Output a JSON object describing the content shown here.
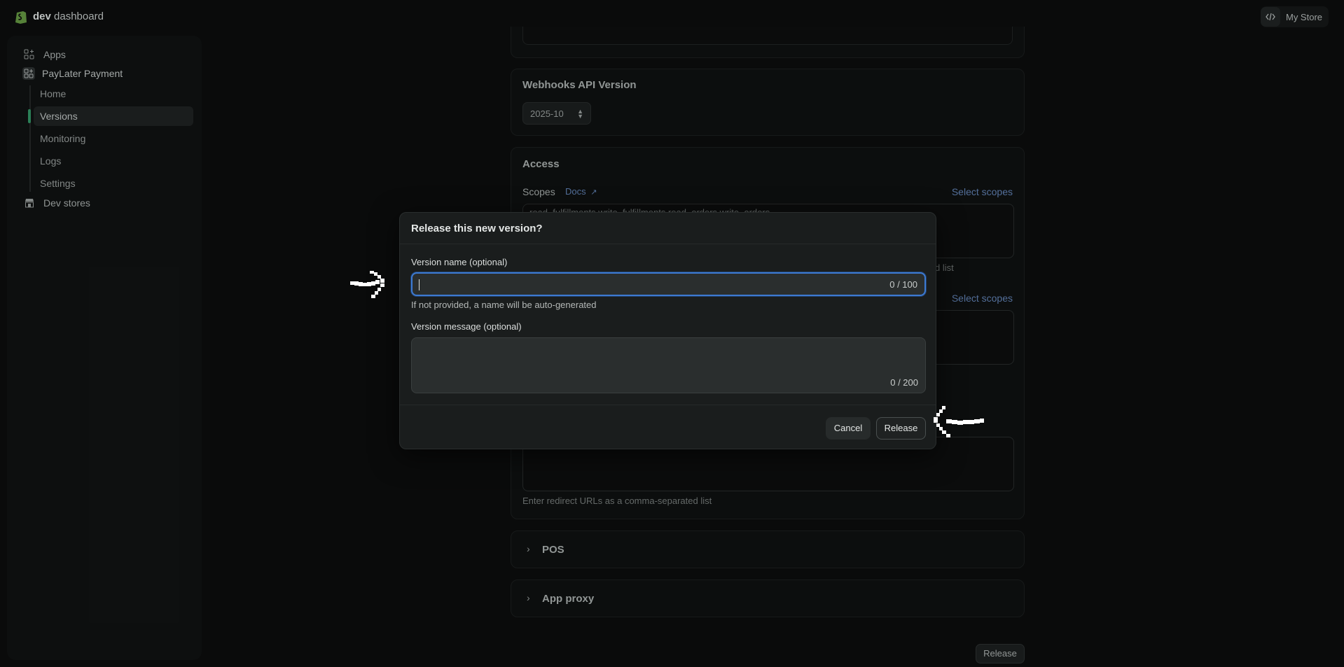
{
  "header": {
    "brand_bold": "dev",
    "brand_rest": "dashboard",
    "store_name": "My Store"
  },
  "sidebar": {
    "apps": "Apps",
    "app_name": "PayLater Payment",
    "sub_items": [
      "Home",
      "Versions",
      "Monitoring",
      "Logs",
      "Settings"
    ],
    "active_sub": "Versions",
    "dev_stores": "Dev stores"
  },
  "main": {
    "webhooks": {
      "title": "Webhooks API Version",
      "selected": "2025-10"
    },
    "access": {
      "title": "Access",
      "scopes_label": "Scopes",
      "docs_label": "Docs",
      "select_scopes": "Select scopes",
      "scopes_value": "read_fulfillments,write_fulfillments,read_orders,write_orders",
      "scopes_help_tail": "d list",
      "select_scopes_2": "Select scopes",
      "redirect_help": "Enter redirect URLs as a comma-separated list"
    },
    "pos": "POS",
    "app_proxy": "App proxy",
    "release_button": "Release"
  },
  "modal": {
    "title": "Release this new version?",
    "name_label": "Version name (optional)",
    "name_value": "",
    "name_counter": "0 / 100",
    "name_help": "If not provided, a name will be auto-generated",
    "message_label": "Version message (optional)",
    "message_value": "",
    "message_counter": "0 / 200",
    "cancel": "Cancel",
    "release": "Release"
  },
  "colors": {
    "accent_focus": "#3d7ad1",
    "active_indicator": "#2f8a5f",
    "link": "#5b79a8"
  },
  "icons": [
    "shopify-logo-icon",
    "code-icon",
    "apps-icon",
    "app-icon",
    "store-icon",
    "external-link-icon",
    "chevron-right-icon",
    "select-arrows-icon",
    "annotation-arrow-right-icon",
    "annotation-arrow-left-icon"
  ]
}
